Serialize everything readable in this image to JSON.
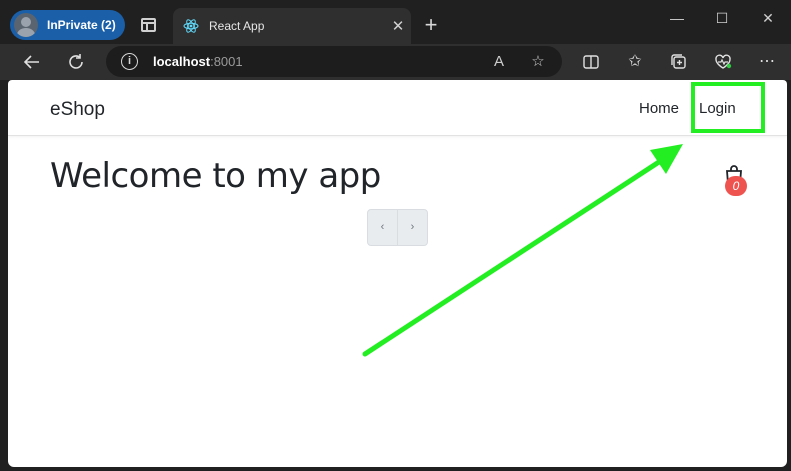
{
  "browser": {
    "profile_label": "InPrivate (2)",
    "tab_title": "React App",
    "tab_close": "✕",
    "new_tab": "+",
    "window_controls": [
      "—",
      "☐",
      "✕"
    ],
    "url_host": "localhost",
    "url_port": ":8001"
  },
  "app": {
    "brand": "eShop",
    "nav": {
      "home": "Home",
      "login": "Login"
    },
    "heading": "Welcome to my app",
    "cart_count": "0",
    "pager": {
      "prev": "‹",
      "next": "›"
    }
  },
  "annotation": {
    "highlight_color": "#22ee22",
    "arrow_color": "#22ee22"
  },
  "colors": {
    "accent_blue": "#1a5fa8",
    "badge_red": "#ef5350"
  }
}
